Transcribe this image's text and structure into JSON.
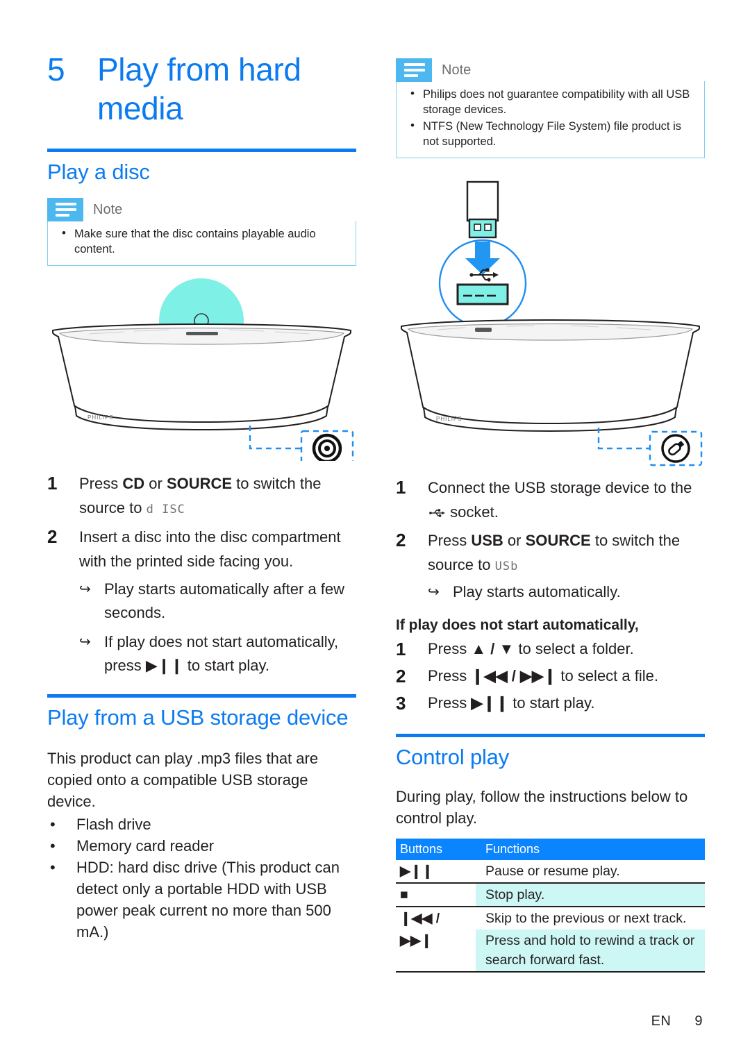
{
  "chapter": {
    "number": "5",
    "title": "Play from hard media"
  },
  "left": {
    "section_heading": "Play a disc",
    "note": {
      "label": "Note",
      "icon": "note-lines-icon",
      "items": [
        "Make sure that the disc contains playable audio content."
      ]
    },
    "illustration": {
      "name": "speaker-with-disc-illustration",
      "disc_icon": "disc-callout-icon",
      "brand": "PHILIPS",
      "disc_color": "#7ef0e6"
    },
    "steps": [
      {
        "num": "1",
        "text_before": "Press ",
        "bold1": "CD",
        "mid": " or ",
        "bold2": "SOURCE",
        "text_after": " to switch the source to ",
        "display": "d ISC"
      },
      {
        "num": "2",
        "text": "Insert a disc into the disc compartment with the printed side facing you.",
        "results": [
          "Play starts automatically after a few seconds.",
          "If play does not start automatically, press ▶❙❙ to start play."
        ]
      }
    ],
    "usb_section": {
      "heading": "Play from a USB storage device",
      "intro": "This product can play .mp3 files that are copied onto a compatible USB storage device.",
      "bullets": [
        "Flash drive",
        "Memory card reader",
        "HDD: hard disc drive (This product can detect only a portable HDD with USB power peak current no more than 500 mA.)"
      ]
    }
  },
  "right": {
    "note": {
      "label": "Note",
      "icon": "note-lines-icon",
      "items": [
        "Philips does not guarantee compatibility with all USB storage devices.",
        "NTFS (New Technology File System) file product is not supported."
      ]
    },
    "illustration": {
      "name": "usb-insertion-illustration",
      "usb_icon": "usb-trident-icon",
      "usb_drive_callout": "usb-drive-callout-icon",
      "brand": "PHILIPS",
      "accent_color": "#7ef0e6",
      "arrow_color": "#1f9cf0"
    },
    "steps": [
      {
        "num": "1",
        "text_before": "Connect the USB storage device to the ",
        "icon": "usb-trident-icon",
        "text_after": " socket."
      },
      {
        "num": "2",
        "text_before": "Press ",
        "bold1": "USB",
        "mid": " or ",
        "bold2": "SOURCE",
        "text_after": " to switch the source to ",
        "display": "USb",
        "results": [
          "Play starts automatically."
        ]
      }
    ],
    "fallback": {
      "heading": "If play does not start automatically,",
      "steps": [
        {
          "num": "1",
          "before": "Press ",
          "glyph": "▲ / ▼",
          "after": " to select a folder."
        },
        {
          "num": "2",
          "before": "Press ",
          "glyph": "❙◀◀ / ▶▶❙",
          "after": " to select a file."
        },
        {
          "num": "3",
          "before": "Press ",
          "glyph": "▶❙❙",
          "after": " to start play."
        }
      ]
    },
    "control": {
      "heading": "Control play",
      "intro": "During play, follow the instructions below to control play.",
      "table": {
        "headers": [
          "Buttons",
          "Functions"
        ],
        "rows": [
          {
            "button": "▶❙❙",
            "function": "Pause or resume play.",
            "highlight": false
          },
          {
            "button": "■",
            "function": "Stop play.",
            "highlight": true
          },
          {
            "button": "❙◀◀ /",
            "function": "Skip to the previous or next track.",
            "highlight": false
          },
          {
            "button": "▶▶❙",
            "function": "Press and hold to rewind a track or search forward fast.",
            "highlight": true
          }
        ]
      }
    }
  },
  "footer": {
    "language": "EN",
    "page": "9"
  },
  "colors": {
    "brand_blue": "#0c7bf0",
    "table_header": "#0b84ff",
    "highlight_cyan": "#cdf7f4",
    "note_badge": "#4db7ef",
    "note_border": "#7fd0f2"
  }
}
